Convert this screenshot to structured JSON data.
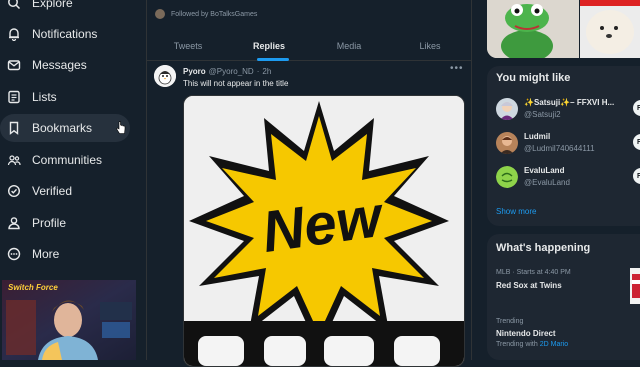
{
  "nav": {
    "items": [
      {
        "label": "Explore",
        "icon": "search-icon"
      },
      {
        "label": "Notifications",
        "icon": "bell-icon"
      },
      {
        "label": "Messages",
        "icon": "envelope-icon"
      },
      {
        "label": "Lists",
        "icon": "list-icon"
      },
      {
        "label": "Bookmarks",
        "icon": "bookmark-icon"
      },
      {
        "label": "Communities",
        "icon": "communities-icon"
      },
      {
        "label": "Verified",
        "icon": "verified-icon"
      },
      {
        "label": "Profile",
        "icon": "profile-icon"
      },
      {
        "label": "More",
        "icon": "more-circle-icon"
      }
    ],
    "hovered": "Bookmarks"
  },
  "webcam": {
    "overlay_text": "Switch Force"
  },
  "profile": {
    "followed_by": "Followed by BoTalksGames"
  },
  "tabs": [
    {
      "label": "Tweets"
    },
    {
      "label": "Replies"
    },
    {
      "label": "Media"
    },
    {
      "label": "Likes"
    }
  ],
  "active_tab": "Replies",
  "tweet": {
    "name": "Pyoro",
    "handle": "@Pyoro_ND",
    "separator": "·",
    "time": "2h",
    "text": "This will not appear in the title",
    "media_text": "New"
  },
  "you_might_like": {
    "title": "You might like",
    "accounts": [
      {
        "name": "✨Satsuji✨– FFXVI H...",
        "handle": "@Satsuji2",
        "follow": "Fo"
      },
      {
        "name": "Ludmil",
        "handle": "@Ludmil740644111",
        "follow": "Fo"
      },
      {
        "name": "EvaluLand",
        "handle": "@EvaluLand",
        "follow": "Fo"
      }
    ],
    "show_more": "Show more"
  },
  "whats_happening": {
    "title": "What's happening",
    "trends": [
      {
        "meta": "MLB · Starts at 4:40 PM",
        "name": "Red Sox at Twins"
      },
      {
        "meta": "Trending",
        "name": "Nintendo Direct",
        "trending_with_label": "Trending with",
        "trending_with": "2D Mario"
      }
    ]
  },
  "colors": {
    "background": "#15202b",
    "accent": "#1d9bf0",
    "starburst": "#f6c800"
  }
}
